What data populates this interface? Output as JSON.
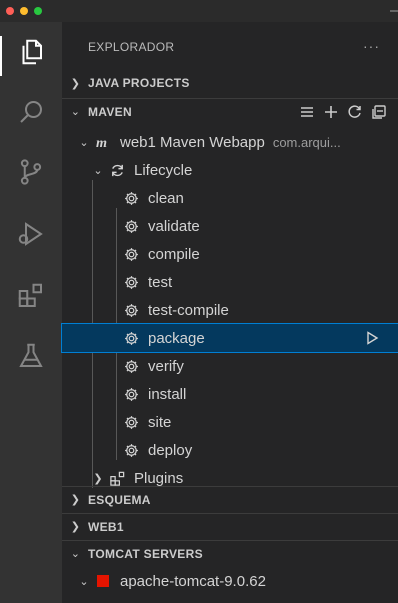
{
  "window": {
    "traffic_lights": [
      "close",
      "minimize",
      "maximize"
    ]
  },
  "activity_bar": {
    "items": [
      {
        "name": "explorer-icon",
        "active": true
      },
      {
        "name": "search-icon",
        "active": false
      },
      {
        "name": "source-control-icon",
        "active": false
      },
      {
        "name": "run-debug-icon",
        "active": false
      },
      {
        "name": "extensions-icon",
        "active": false
      },
      {
        "name": "testing-icon",
        "active": false
      }
    ]
  },
  "sidebar": {
    "title": "EXPLORADOR",
    "more_label": "···",
    "sections": {
      "java_projects": "JAVA PROJECTS",
      "maven": "MAVEN",
      "esquema": "ESQUEMA",
      "web1": "WEB1",
      "tomcat_servers": "TOMCAT SERVERS"
    },
    "maven_actions": [
      "list-icon",
      "add-icon",
      "refresh-icon",
      "collapse-all-icon"
    ],
    "maven_tree": {
      "project_name": "web1 Maven Webapp",
      "project_desc": "com.arqui...",
      "lifecycle_label": "Lifecycle",
      "goals": [
        "clean",
        "validate",
        "compile",
        "test",
        "test-compile",
        "package",
        "verify",
        "install",
        "site",
        "deploy"
      ],
      "selected_goal": "package",
      "plugins_label": "Plugins"
    },
    "tomcat": {
      "server_name": "apache-tomcat-9.0.62",
      "status_color": "#e51400"
    }
  },
  "colors": {
    "selection_bg": "#04395e",
    "selection_border": "#007fd4",
    "activity_bar_bg": "#333333",
    "sidebar_bg": "#252526"
  }
}
